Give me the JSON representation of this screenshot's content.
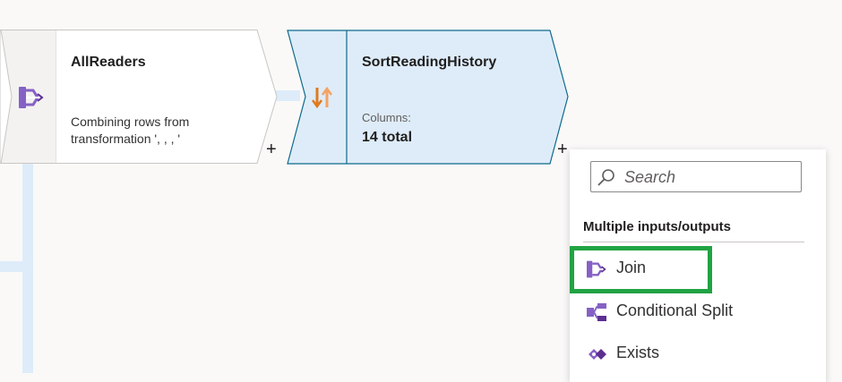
{
  "canvas": {
    "nodes": [
      {
        "title": "AllReaders",
        "description": "Combining rows from transformation ', , , '",
        "icon": "join-icon"
      },
      {
        "title": "SortReadingHistory",
        "columns_label": "Columns:",
        "columns_value": "14 total",
        "icon": "sort-icon"
      }
    ],
    "add_button_label": "+"
  },
  "menu": {
    "search_placeholder": "Search",
    "section_title": "Multiple inputs/outputs",
    "items": [
      {
        "label": "Join",
        "icon": "join-icon",
        "highlighted": true
      },
      {
        "label": "Conditional Split",
        "icon": "conditional-split-icon"
      },
      {
        "label": "Exists",
        "icon": "exists-icon"
      }
    ]
  },
  "colors": {
    "accent_highlight": "#21a344",
    "node_selected_fill": "#deecf9",
    "node_selected_border": "#0f6a8a",
    "icon_purple": "#8661c5"
  }
}
